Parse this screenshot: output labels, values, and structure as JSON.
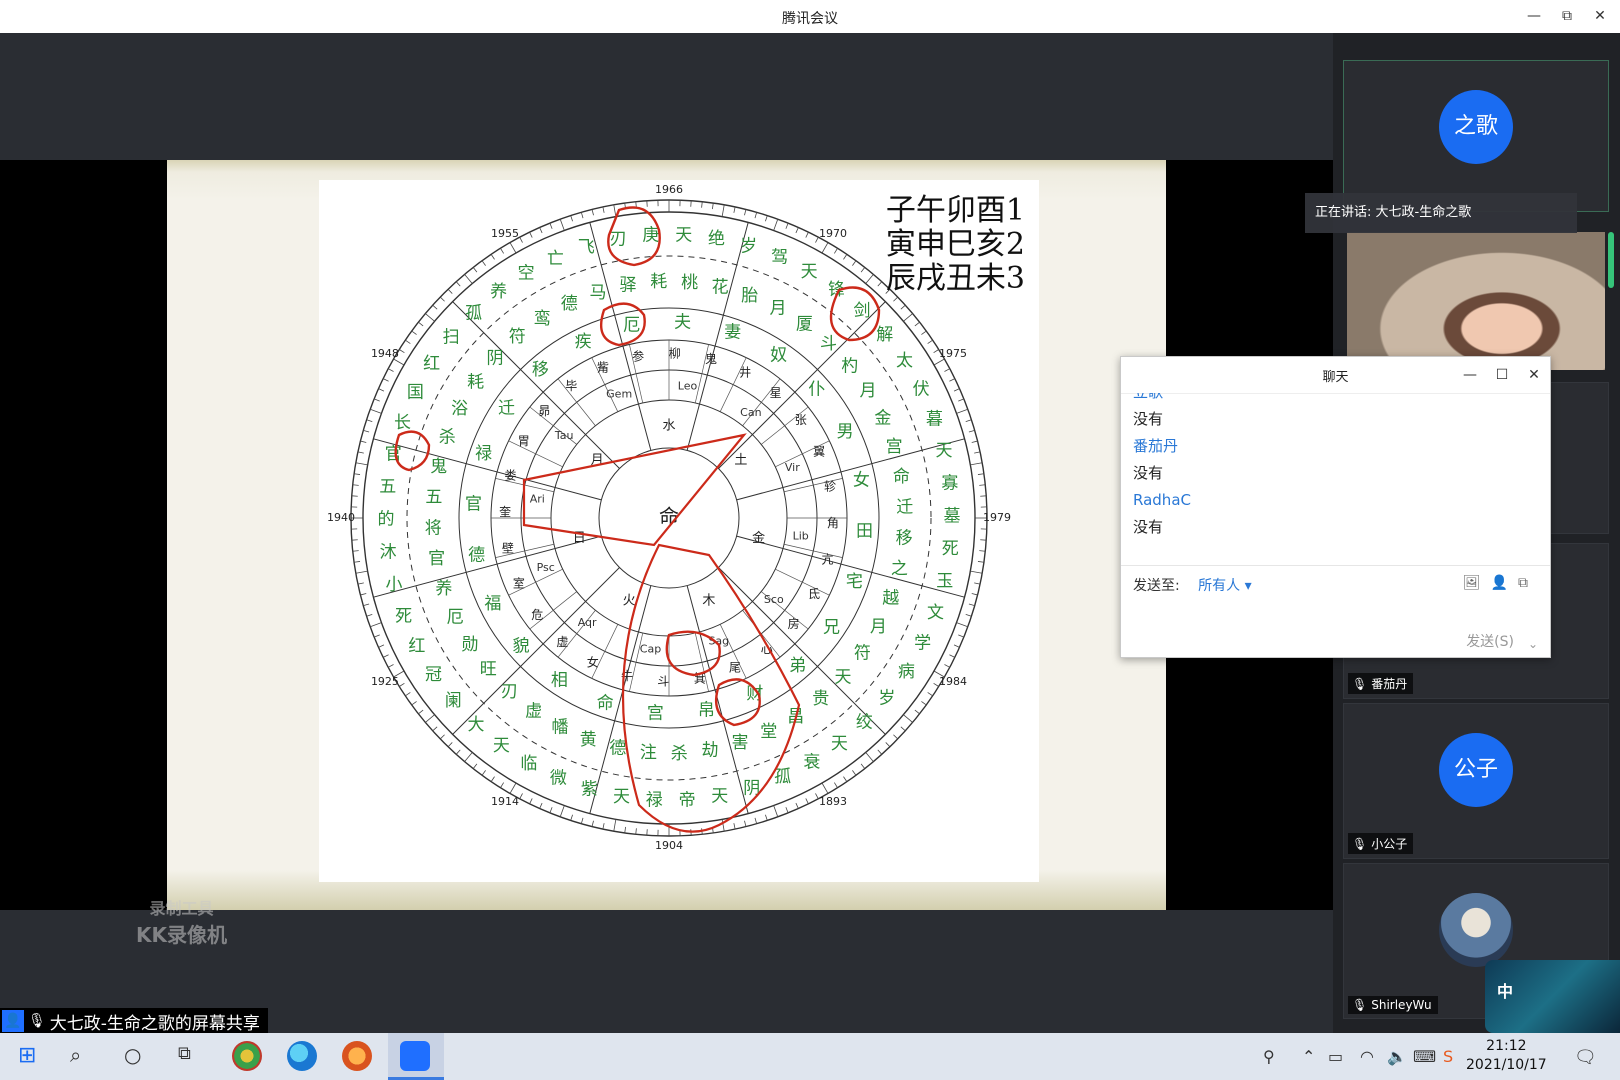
{
  "window": {
    "title": "腾讯会议",
    "minimize": "—",
    "restore": "⧉",
    "close": "✕"
  },
  "slide": {
    "legend": [
      "子午卯酉1",
      "寅申巳亥2",
      "辰戌丑未3"
    ],
    "years": [
      "1966",
      "1970",
      "1975",
      "1979",
      "1984",
      "1893",
      "1904",
      "1914",
      "1925",
      "1940",
      "1948",
      "1955"
    ],
    "center_word": "命",
    "ring_outer": [
      "天",
      "绝",
      "岁",
      "驾",
      "天",
      "锋",
      "剑",
      "解",
      "太",
      "伏",
      "暮",
      "天",
      "寡",
      "墓",
      "死",
      "玉",
      "文",
      "学",
      "病",
      "岁",
      "绞",
      "天",
      "衰",
      "孤",
      "阴",
      "天",
      "帝",
      "禄",
      "天",
      "紫",
      "微",
      "临",
      "天",
      "大",
      "阑",
      "冠",
      "红",
      "死",
      "小",
      "沐",
      "的",
      "五",
      "官",
      "长",
      "国",
      "红",
      "扫",
      "孤",
      "养",
      "空",
      "亡",
      "飞",
      "刃",
      "庚"
    ],
    "ring_mid": [
      "桃",
      "花",
      "胎",
      "月",
      "厦",
      "斗",
      "杓",
      "月",
      "金",
      "宫",
      "命",
      "迁",
      "移",
      "之",
      "越",
      "月",
      "符",
      "天",
      "贵",
      "昌",
      "堂",
      "害",
      "劫",
      "杀",
      "注",
      "德",
      "黄",
      "幡",
      "虚",
      "刃",
      "旺",
      "勋",
      "厄",
      "养",
      "官",
      "将",
      "五",
      "鬼",
      "杀",
      "浴",
      "耗",
      "阴",
      "符",
      "鸾",
      "德",
      "马",
      "驿",
      "耗"
    ],
    "ring_inner": [
      "柳",
      "鬼",
      "井",
      "星",
      "张",
      "翼",
      "轸",
      "角",
      "亢",
      "氐",
      "房",
      "心",
      "尾",
      "箕",
      "斗",
      "牛",
      "女",
      "虚",
      "危",
      "室",
      "壁",
      "奎",
      "娄",
      "胃",
      "昴",
      "毕",
      "觜",
      "参"
    ],
    "ring_core": [
      "夫",
      "妻",
      "奴",
      "仆",
      "男",
      "女",
      "田",
      "宅",
      "兄",
      "弟",
      "财",
      "帛",
      "宫",
      "命",
      "相",
      "貌",
      "福",
      "德",
      "官",
      "禄",
      "迁",
      "移",
      "疾",
      "厄"
    ],
    "zodiac": [
      "Leo",
      "Can",
      "Vir",
      "Lib",
      "Sco",
      "Sag",
      "Cap",
      "Aqr",
      "Psc",
      "Ari",
      "Tau",
      "Gem"
    ],
    "elements": [
      "水",
      "土",
      "金",
      "木",
      "火",
      "日",
      "月"
    ]
  },
  "recorder_watermark": {
    "line1": "录制工具",
    "line2": "KK录像机"
  },
  "share_bar": {
    "label": "大七政-生命之歌的屏幕共享"
  },
  "sidebar": {
    "participants": [
      {
        "name": "之歌",
        "avatar_text": "之歌",
        "color": "#1a6cf2"
      },
      {
        "name": "番茄丹"
      },
      {
        "name": "小公子",
        "avatar_text": "公子",
        "color": "#1a6cf2"
      },
      {
        "name": "ShirleyWu"
      }
    ],
    "speaking_label": "正在讲话: 大七政-生命之歌"
  },
  "chat": {
    "title": "聊天",
    "messages": [
      {
        "sender": "立歌",
        "text": "没有"
      },
      {
        "sender": "番茄丹",
        "text": "没有"
      },
      {
        "sender": "RadhaC",
        "text": "没有"
      }
    ],
    "send_to_label": "发送至:",
    "send_to_value": "所有人",
    "send_button": "发送(S)"
  },
  "ime": {
    "label": "中"
  },
  "taskbar": {
    "time": "21:12",
    "date": "2021/10/17"
  },
  "colors": {
    "chart_green": "#2e8b3a",
    "chart_red": "#cc2a1a",
    "accent": "#1a6cf2"
  }
}
